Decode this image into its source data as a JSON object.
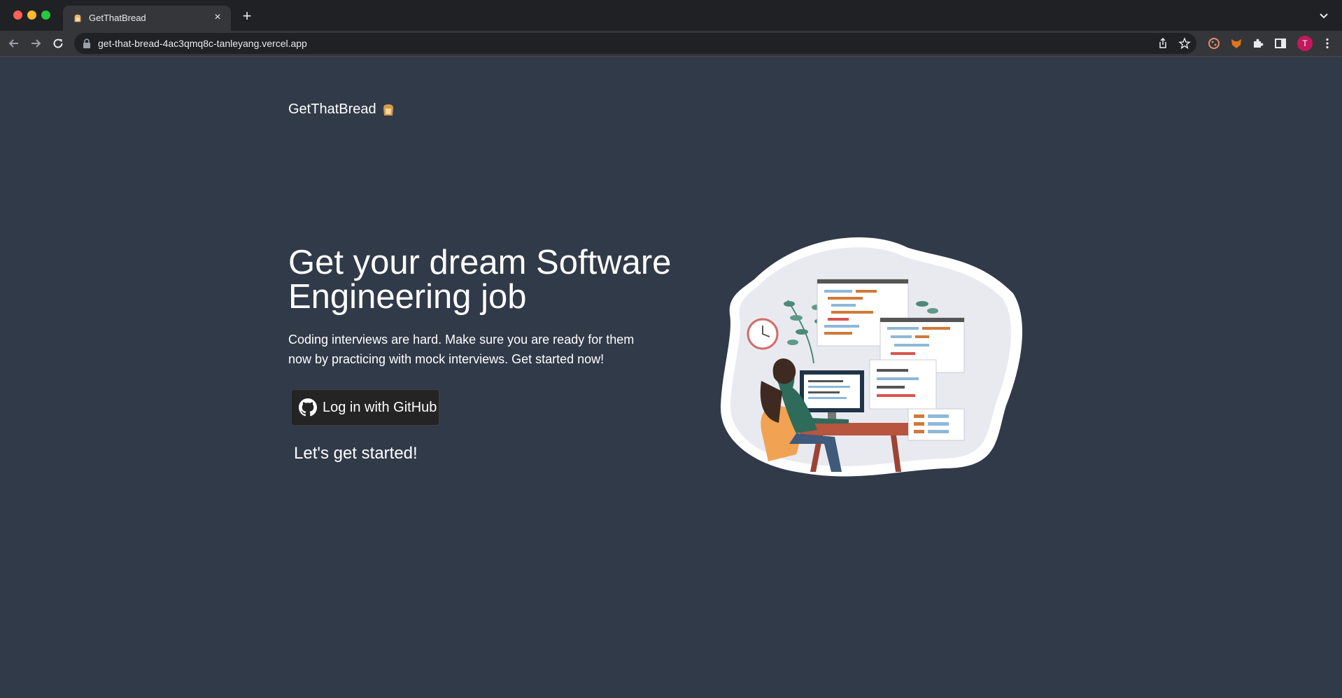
{
  "browser": {
    "tab_title": "GetThatBread",
    "url": "get-that-bread-4ac3qmq8c-tanleyang.vercel.app",
    "profile_initial": "T",
    "colors": {
      "profile": "#c2185b",
      "page_bg": "#313a48"
    }
  },
  "header": {
    "brand": "GetThatBread"
  },
  "hero": {
    "title": "Get your dream Software Engineering job",
    "subtitle": "Coding interviews are hard. Make sure you are ready for them now by practicing with mock interviews. Get started now!",
    "github_button": "Log in with GitHub",
    "cta": "Let's get started!"
  },
  "icons": [
    "bread-icon",
    "github-icon",
    "lock-icon",
    "back-icon",
    "forward-icon",
    "reload-icon",
    "share-icon",
    "star-icon",
    "puzzle-icon",
    "sidebar-icon",
    "kebab-menu-icon"
  ]
}
